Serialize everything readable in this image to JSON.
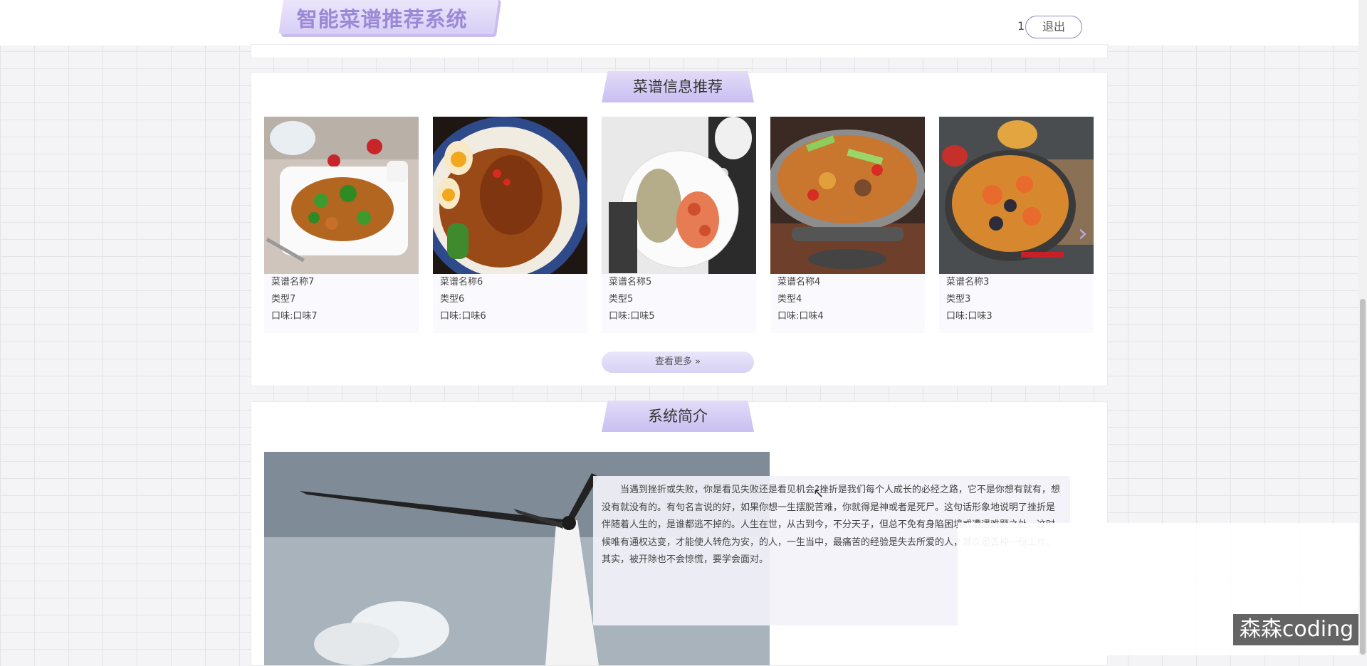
{
  "header": {
    "brand": "智能菜谱推荐系统",
    "user_label": "1",
    "logout_label": "退出"
  },
  "recommend": {
    "title": "菜谱信息推荐",
    "more_label": "查看更多 »",
    "items": [
      {
        "name": "菜谱名称7",
        "type": "类型7",
        "taste": "口味:口味7",
        "photo": "chicken-peppers-photo"
      },
      {
        "name": "菜谱名称6",
        "type": "类型6",
        "taste": "口味:口味6",
        "photo": "braised-chicken-photo"
      },
      {
        "name": "菜谱名称5",
        "type": "类型5",
        "taste": "口味:口味5",
        "photo": "rice-shrimp-photo"
      },
      {
        "name": "菜谱名称4",
        "type": "类型4",
        "taste": "口味:口味4",
        "photo": "dry-pot-photo"
      },
      {
        "name": "菜谱名称3",
        "type": "类型3",
        "taste": "口味:口味3",
        "photo": "seafood-paella-photo"
      }
    ]
  },
  "intro": {
    "title": "系统简介",
    "text": "当遇到挫折或失败，你是看见失败还是看见机会?挫折是我们每个人成长的必经之路，它不是你想有就有，想没有就没有的。有句名言说的好，如果你想一生摆脱苦难，你就得是神或者是死尸。这句话形象地说明了挫折是伴随着人生的，是谁都逃不掉的。人生在世，从古到今，不分天子，但总不免有身陷困境或遭遇难题之处，这时候唯有通权达变，才能使人转危为安，的人，一生当中，最痛苦的经验是失去所爱的人，其次是丢掉一份工作。其实，被开除也不会惊慌，要学会面对。"
  },
  "watermark": "森森coding",
  "colors": {
    "accent": "#c9bff1",
    "brand_text": "#9b88d6"
  }
}
